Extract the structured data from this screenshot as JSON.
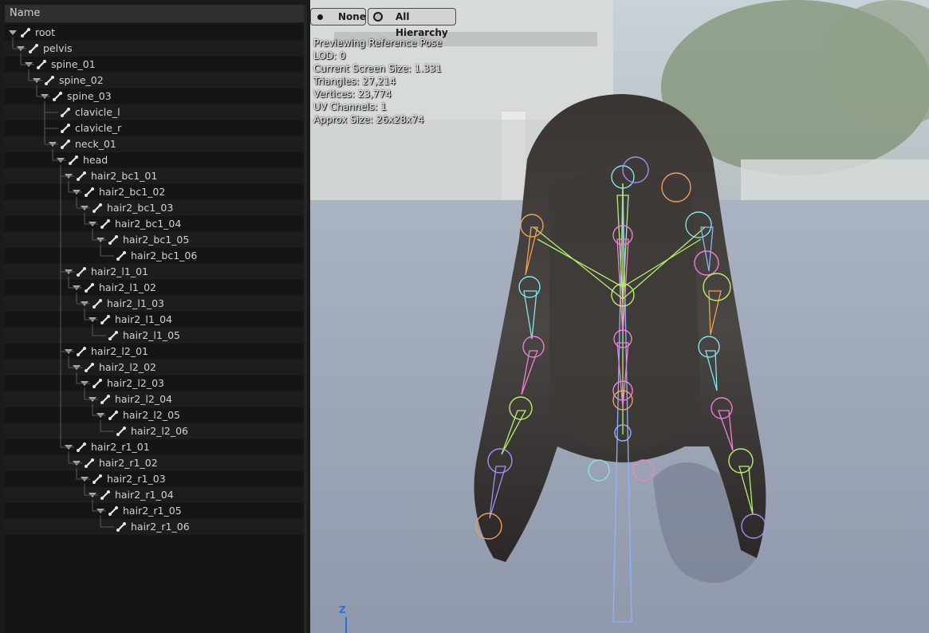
{
  "tree": {
    "header": "Name",
    "items": [
      {
        "label": "root",
        "depth": 0
      },
      {
        "label": "pelvis",
        "depth": 1
      },
      {
        "label": "spine_01",
        "depth": 2
      },
      {
        "label": "spine_02",
        "depth": 3
      },
      {
        "label": "spine_03",
        "depth": 4
      },
      {
        "label": "clavicle_l",
        "depth": 5
      },
      {
        "label": "clavicle_r",
        "depth": 5
      },
      {
        "label": "neck_01",
        "depth": 5
      },
      {
        "label": "head",
        "depth": 6
      },
      {
        "label": "hair2_bc1_01",
        "depth": 7
      },
      {
        "label": "hair2_bc1_02",
        "depth": 8
      },
      {
        "label": "hair2_bc1_03",
        "depth": 9
      },
      {
        "label": "hair2_bc1_04",
        "depth": 10
      },
      {
        "label": "hair2_bc1_05",
        "depth": 11
      },
      {
        "label": "hair2_bc1_06",
        "depth": 12
      },
      {
        "label": "hair2_l1_01",
        "depth": 7
      },
      {
        "label": "hair2_l1_02",
        "depth": 8
      },
      {
        "label": "hair2_l1_03",
        "depth": 9
      },
      {
        "label": "hair2_l1_04",
        "depth": 10
      },
      {
        "label": "hair2_l1_05",
        "depth": 11
      },
      {
        "label": "hair2_l2_01",
        "depth": 7
      },
      {
        "label": "hair2_l2_02",
        "depth": 8
      },
      {
        "label": "hair2_l2_03",
        "depth": 9
      },
      {
        "label": "hair2_l2_04",
        "depth": 10
      },
      {
        "label": "hair2_l2_05",
        "depth": 11
      },
      {
        "label": "hair2_l2_06",
        "depth": 12
      },
      {
        "label": "hair2_r1_01",
        "depth": 7
      },
      {
        "label": "hair2_r1_02",
        "depth": 8
      },
      {
        "label": "hair2_r1_03",
        "depth": 9
      },
      {
        "label": "hair2_r1_04",
        "depth": 10
      },
      {
        "label": "hair2_r1_05",
        "depth": 11
      },
      {
        "label": "hair2_r1_06",
        "depth": 12
      }
    ]
  },
  "viewport": {
    "buttons": {
      "none_label": "None",
      "hierarchy_label": "All Hierarchy"
    },
    "stats": {
      "line1": "Previewing Reference Pose",
      "line2": "LOD: 0",
      "line3": "Current Screen Size: 1.331",
      "line4": "Triangles: 27,214",
      "line5": "Vertices: 23,774",
      "line6": "UV Channels: 1",
      "line7": "Approx Size: 26x28x74"
    },
    "axis_label": "Z"
  },
  "colors": {
    "panel_bg": "#1a1a1a",
    "accent_axis": "#2a6fdd",
    "bone_cyan": "#7fe6f0",
    "bone_pink": "#f07fd8",
    "bone_green": "#b6f06a",
    "bone_orange": "#f0a055",
    "bone_purple": "#a98cf5",
    "bone_blue": "#8fb2ff"
  }
}
